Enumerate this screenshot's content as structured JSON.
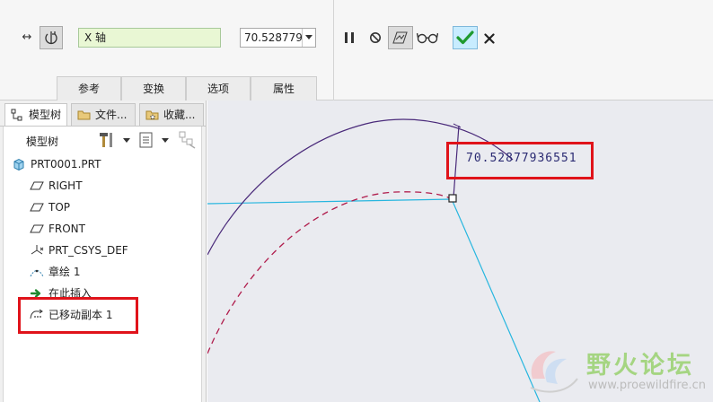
{
  "dashboard": {
    "reference_field": "X 轴",
    "value_field": "70.5287793",
    "tabs": [
      {
        "label": "参考"
      },
      {
        "label": "变换"
      },
      {
        "label": "选项"
      },
      {
        "label": "属性"
      }
    ]
  },
  "navigator": {
    "tabs": [
      {
        "label": "模型树"
      },
      {
        "label": "文件..."
      },
      {
        "label": "收藏..."
      }
    ],
    "tree_header": "模型树",
    "items": [
      {
        "label": "PRT0001.PRT",
        "icon": "part-icon"
      },
      {
        "label": "RIGHT",
        "icon": "datum-plane-icon"
      },
      {
        "label": "TOP",
        "icon": "datum-plane-icon"
      },
      {
        "label": "FRONT",
        "icon": "datum-plane-icon"
      },
      {
        "label": "PRT_CSYS_DEF",
        "icon": "csys-icon"
      },
      {
        "label": "章绘 1",
        "icon": "sketch-icon"
      },
      {
        "label": "在此插入",
        "icon": "insert-arrow-icon"
      },
      {
        "label": "已移动副本 1",
        "icon": "moved-copy-icon"
      }
    ]
  },
  "graphics": {
    "dimension_value": "70.52877936551"
  },
  "watermark": {
    "name": "野火论坛",
    "url": "www.proewildfire.cn"
  },
  "colors": {
    "reference_field_bg": "#e9f7d4",
    "ok_button_bg": "#c8ecff",
    "ok_check": "#1f9a2f",
    "highlight_box": "#e0131a",
    "copied_curve": "#4a2a7a",
    "original_curve": "#b01c4c",
    "reference_line": "#27b6df",
    "graphics_bg": "#eaebf0"
  }
}
